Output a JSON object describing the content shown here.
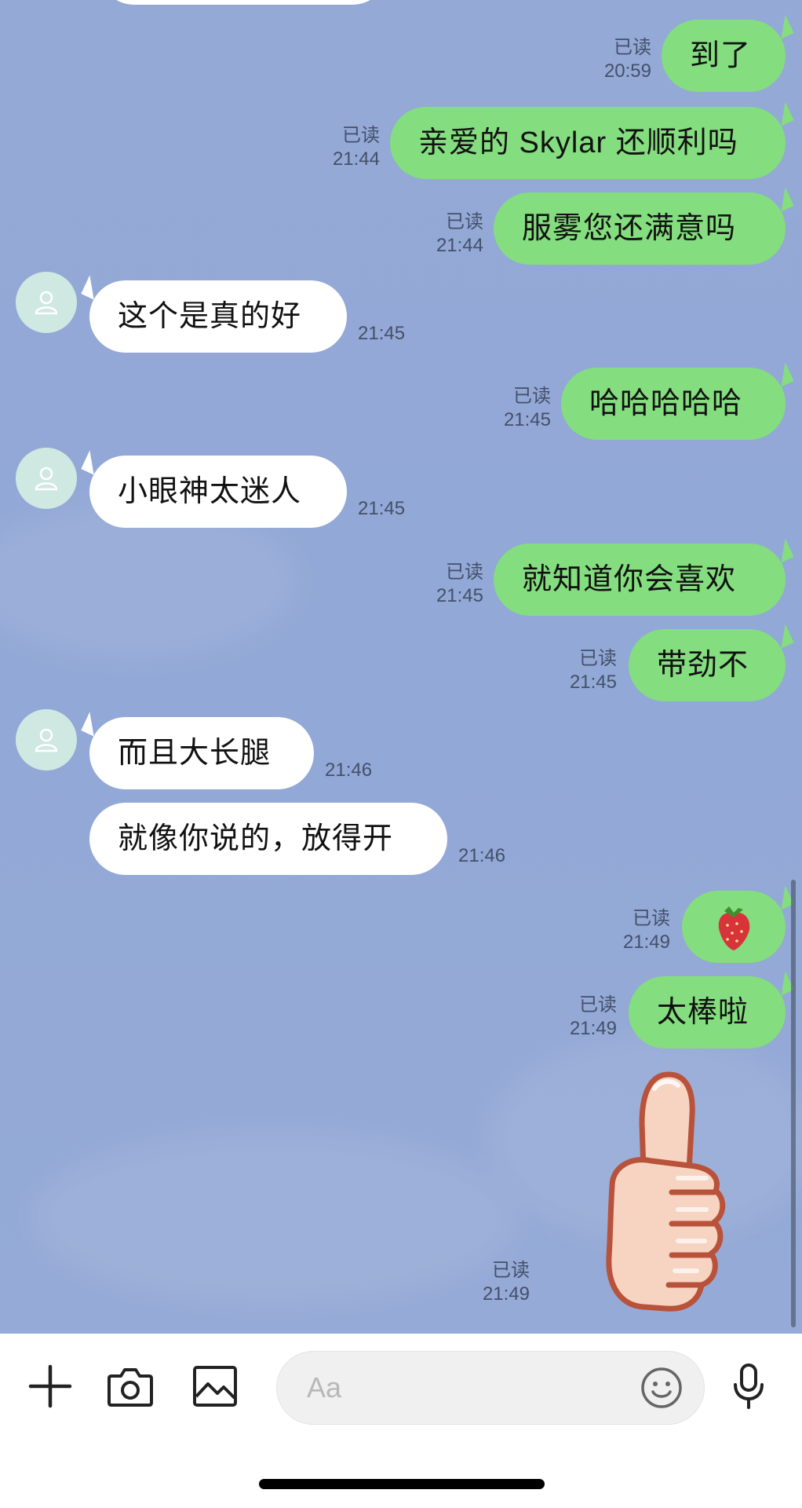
{
  "read_label": "已读",
  "colors": {
    "background": "#94a9d5",
    "outgoing_bubble": "#84dd7e",
    "incoming_bubble": "#ffffff",
    "avatar": "#cfe8e2"
  },
  "messages": [
    {
      "direction": "outgoing",
      "text": "到了",
      "read": "已读",
      "time": "20:59"
    },
    {
      "direction": "outgoing",
      "text": "亲爱的 Skylar 还顺利吗",
      "read": "已读",
      "time": "21:44"
    },
    {
      "direction": "outgoing",
      "text": "服雾您还满意吗",
      "read": "已读",
      "time": "21:44"
    },
    {
      "direction": "incoming",
      "text": "这个是真的好",
      "time": "21:45"
    },
    {
      "direction": "outgoing",
      "text": "哈哈哈哈哈",
      "read": "已读",
      "time": "21:45"
    },
    {
      "direction": "incoming",
      "text": "小眼神太迷人",
      "time": "21:45"
    },
    {
      "direction": "outgoing",
      "text": "就知道你会喜欢",
      "read": "已读",
      "time": "21:45"
    },
    {
      "direction": "outgoing",
      "text": "带劲不",
      "read": "已读",
      "time": "21:45"
    },
    {
      "direction": "incoming",
      "text": "而且大长腿",
      "time": "21:46"
    },
    {
      "direction": "incoming",
      "text": "就像你说的，放得开",
      "time": "21:46"
    },
    {
      "direction": "outgoing",
      "emoji": "strawberry-icon",
      "read": "已读",
      "time": "21:49"
    },
    {
      "direction": "outgoing",
      "text": "太棒啦",
      "read": "已读",
      "time": "21:49"
    },
    {
      "direction": "outgoing",
      "sticker": "thumbs-up-sticker",
      "read": "已读",
      "time": "21:49"
    }
  ],
  "input": {
    "placeholder": "Aa",
    "icons": [
      "plus-icon",
      "camera-icon",
      "image-icon",
      "emoji-icon",
      "microphone-icon"
    ]
  }
}
